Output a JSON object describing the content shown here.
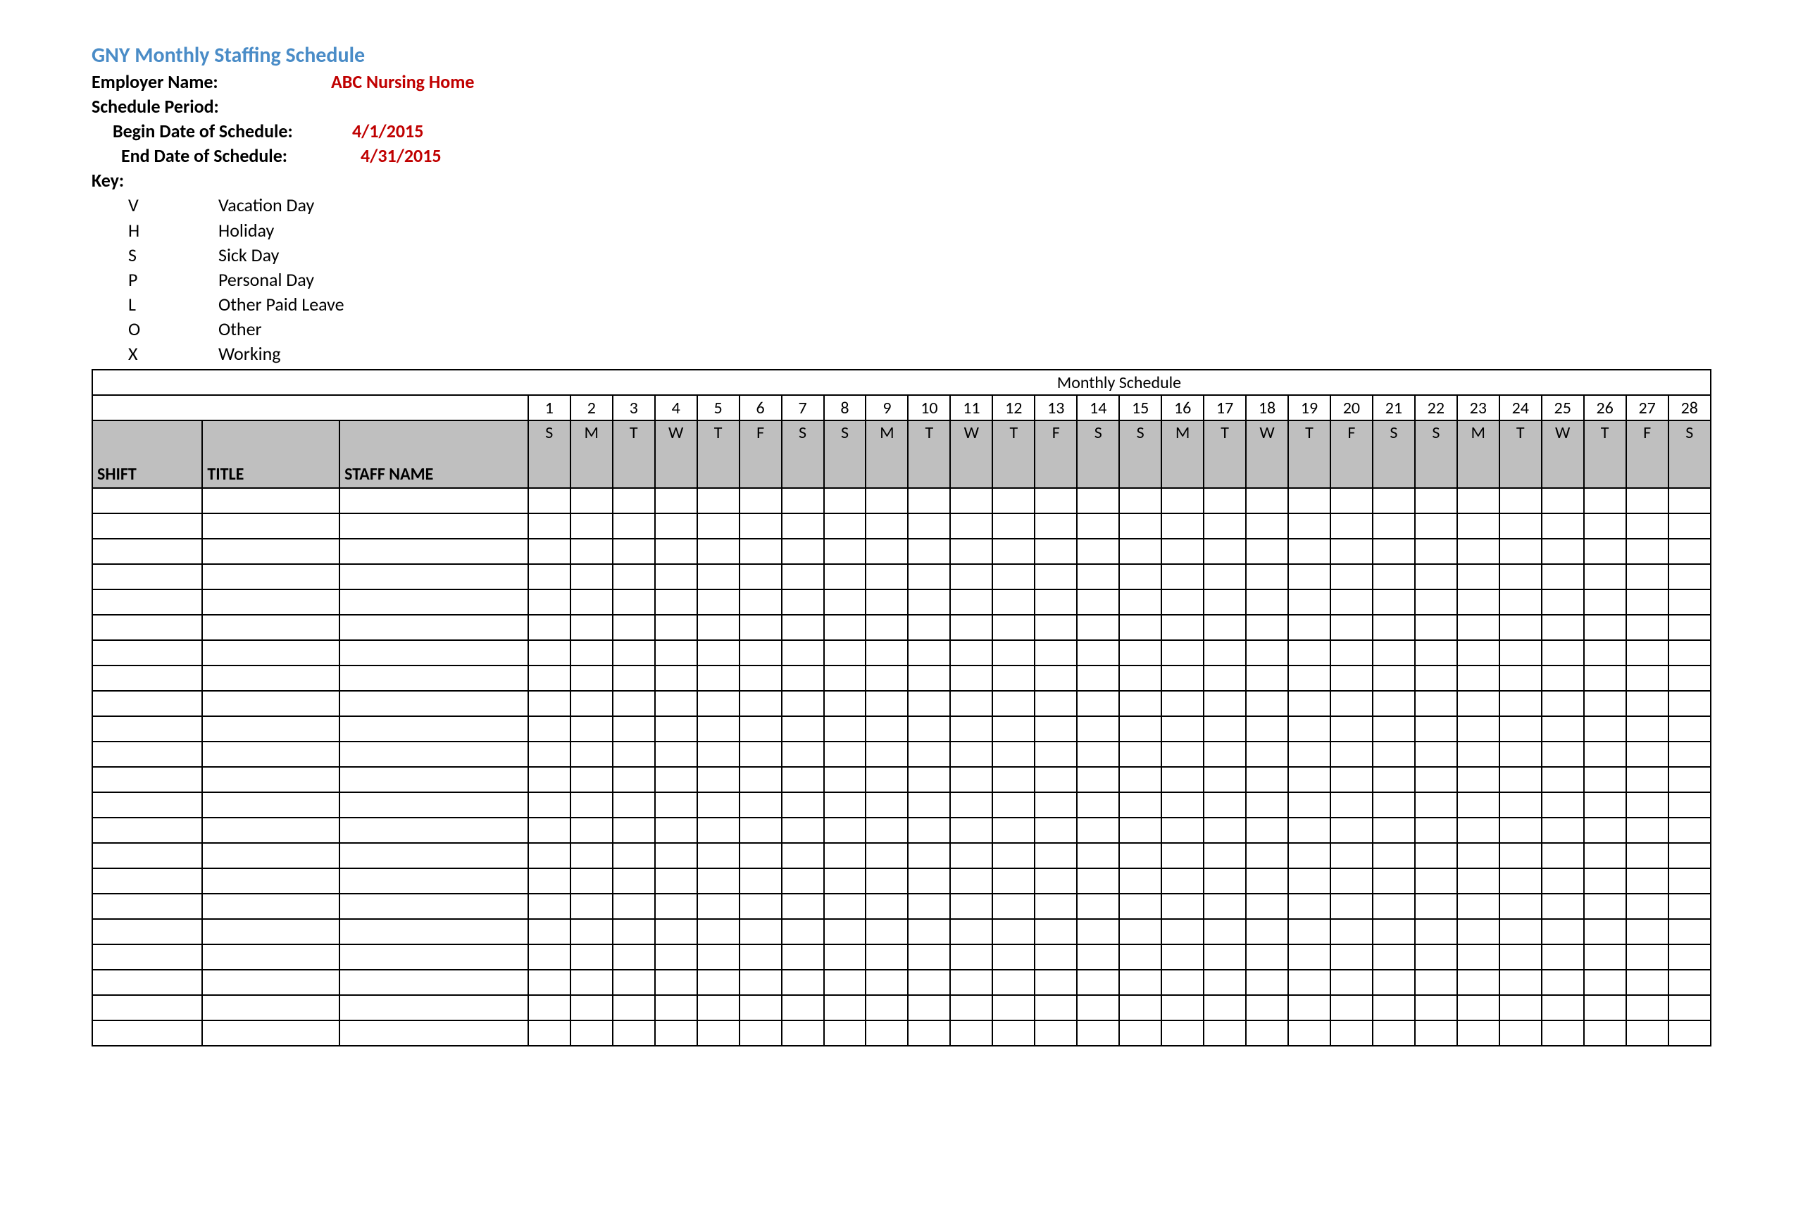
{
  "title": "GNY Monthly Staffing Schedule",
  "header": {
    "employer_label": "Employer Name:",
    "employer_value": "ABC Nursing Home",
    "schedule_period_label": "Schedule Period:",
    "begin_label": "Begin Date of Schedule:",
    "begin_value": "4/1/2015",
    "end_label": "End Date of Schedule:",
    "end_value": "4/31/2015"
  },
  "key_label": "Key:",
  "key": [
    {
      "code": "V",
      "desc": "Vacation Day"
    },
    {
      "code": "H",
      "desc": "Holiday"
    },
    {
      "code": "S",
      "desc": "Sick Day"
    },
    {
      "code": "P",
      "desc": "Personal Day"
    },
    {
      "code": "L",
      "desc": "Other Paid Leave"
    },
    {
      "code": "O",
      "desc": "Other"
    },
    {
      "code": "X",
      "desc": "Working"
    }
  ],
  "table": {
    "monthly_title": "Monthly Schedule",
    "lead_headers": [
      "SHIFT",
      "TITLE",
      "STAFF NAME"
    ],
    "day_numbers": [
      "1",
      "2",
      "3",
      "4",
      "5",
      "6",
      "7",
      "8",
      "9",
      "10",
      "11",
      "12",
      "13",
      "14",
      "15",
      "16",
      "17",
      "18",
      "19",
      "20",
      "21",
      "22",
      "23",
      "24",
      "25",
      "26",
      "27",
      "28"
    ],
    "day_of_week": [
      "S",
      "M",
      "T",
      "W",
      "T",
      "F",
      "S",
      "S",
      "M",
      "T",
      "W",
      "T",
      "F",
      "S",
      "S",
      "M",
      "T",
      "W",
      "T",
      "F",
      "S",
      "S",
      "M",
      "T",
      "W",
      "T",
      "F",
      "S"
    ],
    "blank_rows": 22
  }
}
